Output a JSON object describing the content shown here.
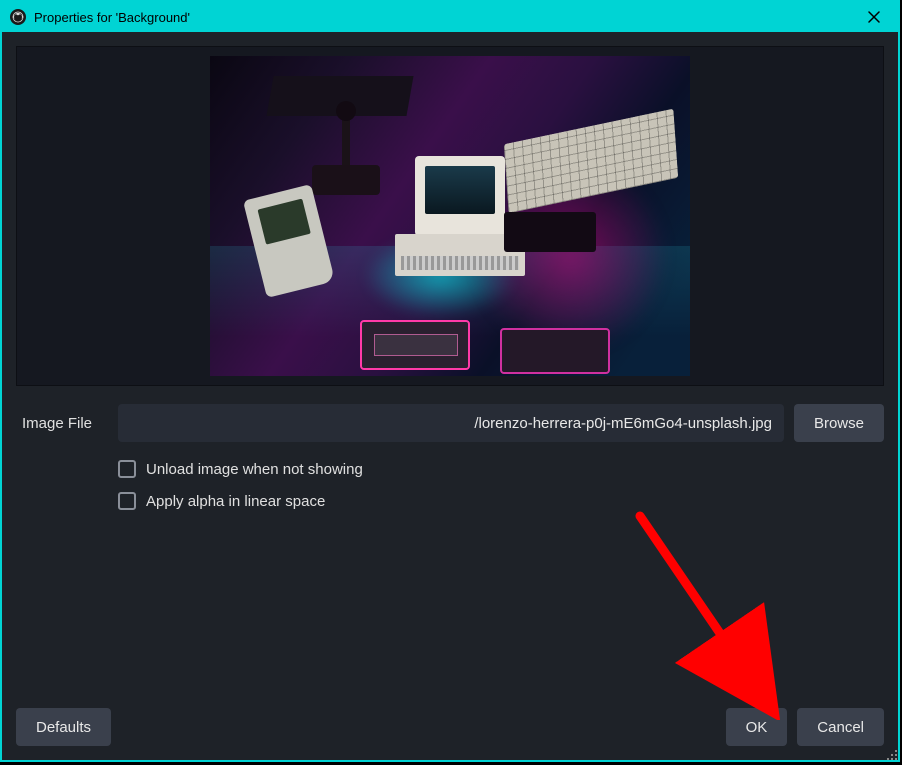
{
  "titlebar": {
    "title": "Properties for 'Background'"
  },
  "form": {
    "image_file_label": "Image File",
    "image_file_value": "/lorenzo-herrera-p0j-mE6mGo4-unsplash.jpg",
    "browse_label": "Browse",
    "unload_label": "Unload image when not showing",
    "unload_checked": false,
    "alpha_label": "Apply alpha in linear space",
    "alpha_checked": false
  },
  "footer": {
    "defaults_label": "Defaults",
    "ok_label": "OK",
    "cancel_label": "Cancel"
  },
  "colors": {
    "accent": "#00d4d4",
    "panel": "#1e2228",
    "field": "#272c36",
    "button": "#3a404c",
    "text": "#e0e0e0"
  }
}
